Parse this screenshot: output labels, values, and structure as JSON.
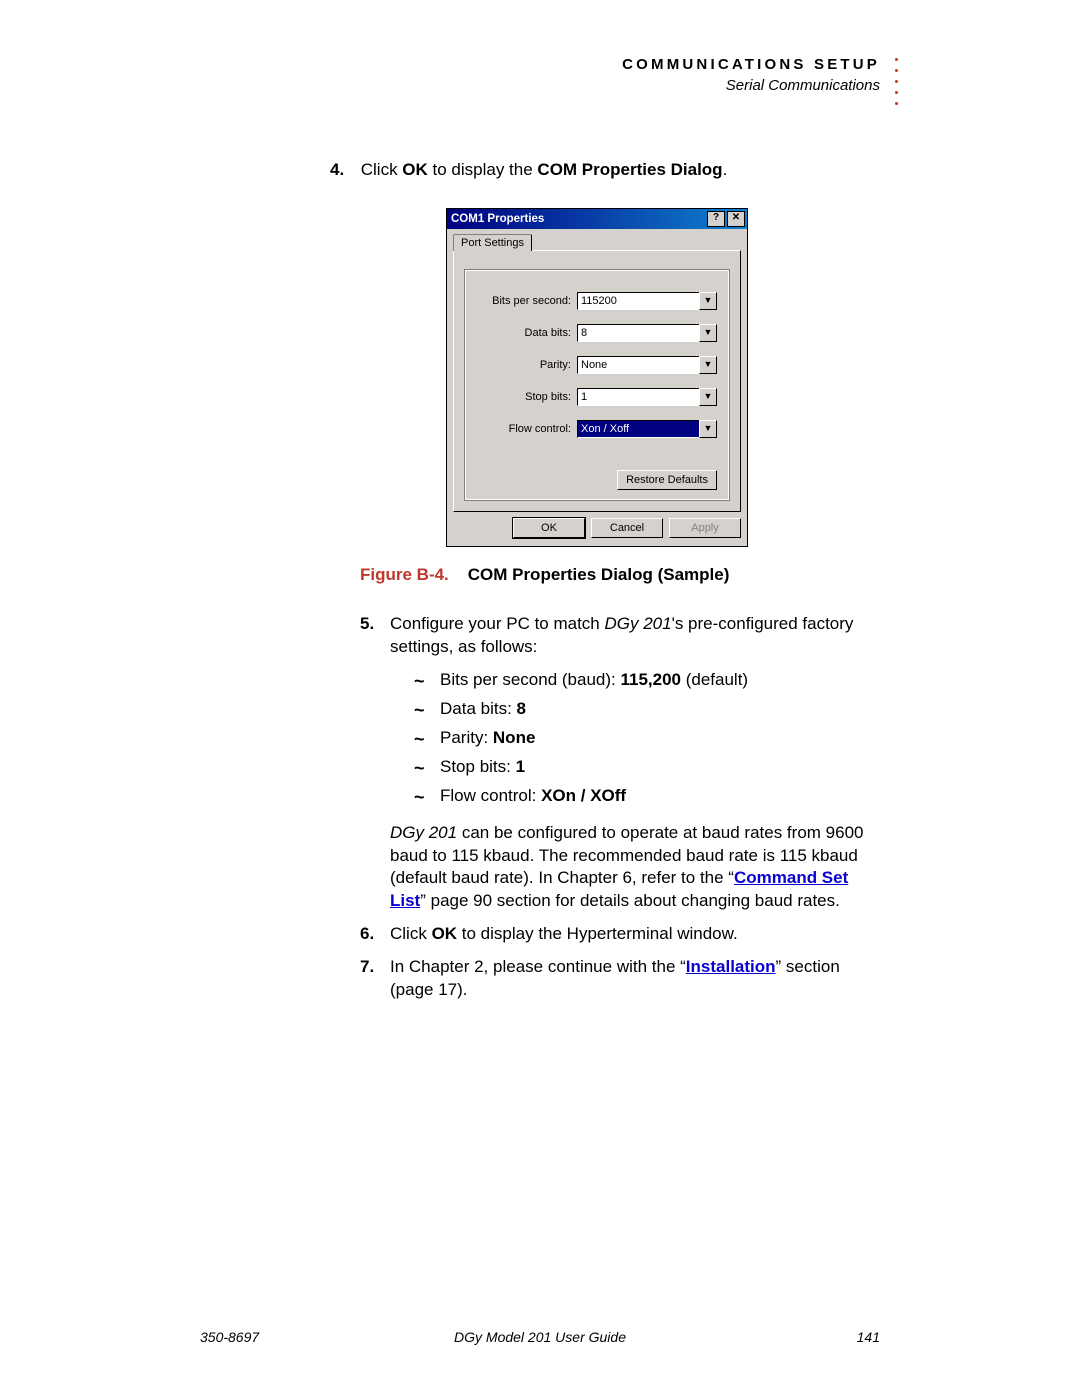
{
  "header": {
    "chapter": "COMMUNICATIONS SETUP",
    "section": "Serial Communications"
  },
  "step4": {
    "num": "4.",
    "text_pre": "Click ",
    "ok": "OK",
    "text_mid": " to display the ",
    "bold_end": "COM Properties Dialog",
    "tail": "."
  },
  "dialog": {
    "title": "COM1 Properties",
    "help_glyph": "?",
    "close_glyph": "✕",
    "tab": "Port Settings",
    "fields": {
      "bps_label": "Bits per second:",
      "bps_value": "115200",
      "databits_label": "Data bits:",
      "databits_value": "8",
      "parity_label": "Parity:",
      "parity_value": "None",
      "stopbits_label": "Stop bits:",
      "stopbits_value": "1",
      "flow_label": "Flow control:",
      "flow_value": "Xon / Xoff"
    },
    "restore": "Restore Defaults",
    "ok": "OK",
    "cancel": "Cancel",
    "apply": "Apply"
  },
  "figure": {
    "label": "Figure B-4.",
    "caption": "COM Properties Dialog (Sample)"
  },
  "step5": {
    "num": "5.",
    "text_a": "Configure your PC to match ",
    "product": "DGy 201",
    "text_b": "'s pre-configured factory settings, as follows:",
    "items": {
      "bps_pre": "Bits per second (baud): ",
      "bps_bold": "115,200",
      "bps_post": " (default)",
      "databits_pre": "Data bits: ",
      "databits_bold": "8",
      "parity_pre": "Parity: ",
      "parity_bold": "None",
      "stopbits_pre": "Stop bits: ",
      "stopbits_bold": "1",
      "flow_pre": "Flow control: ",
      "flow_bold": "XOn / XOff"
    },
    "para_a": " can be configured to operate at baud rates from 9600 baud to 115 kbaud. The recommended baud rate is 115 kbaud (default baud rate). In Chapter 6, refer to the “",
    "link": "Command Set List",
    "para_c": "” page 90 section for details about changing baud rates."
  },
  "step6": {
    "num": "6.",
    "pre": "Click ",
    "ok": "OK",
    "post": " to display the Hyperterminal window."
  },
  "step7": {
    "num": "7.",
    "pre": "In Chapter 2, please continue with the “",
    "link": "Installation",
    "post": "” section (page 17)."
  },
  "footer": {
    "left": "350-8697",
    "center": "DGy Model 201 User Guide",
    "right": "141"
  }
}
